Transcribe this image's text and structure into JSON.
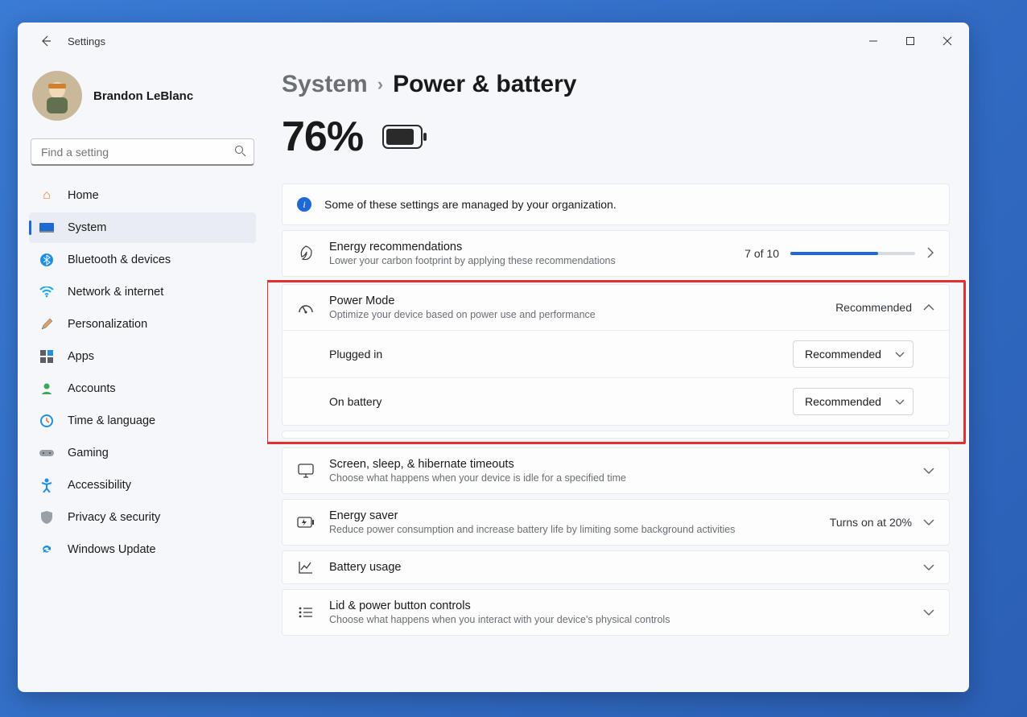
{
  "window": {
    "title": "Settings"
  },
  "user": {
    "name": "Brandon LeBlanc"
  },
  "search": {
    "placeholder": "Find a setting"
  },
  "nav": {
    "items": [
      {
        "label": "Home"
      },
      {
        "label": "System"
      },
      {
        "label": "Bluetooth & devices"
      },
      {
        "label": "Network & internet"
      },
      {
        "label": "Personalization"
      },
      {
        "label": "Apps"
      },
      {
        "label": "Accounts"
      },
      {
        "label": "Time & language"
      },
      {
        "label": "Gaming"
      },
      {
        "label": "Accessibility"
      },
      {
        "label": "Privacy & security"
      },
      {
        "label": "Windows Update"
      }
    ]
  },
  "breadcrumb": {
    "parent": "System",
    "current": "Power & battery"
  },
  "battery": {
    "level": "76%"
  },
  "banner": {
    "text": "Some of these settings are managed by your organization."
  },
  "energy": {
    "title": "Energy recommendations",
    "sub": "Lower your carbon footprint by applying these recommendations",
    "progress_label": "7 of 10",
    "progress_pct": 70
  },
  "power_mode": {
    "title": "Power Mode",
    "sub": "Optimize your device based on power use and performance",
    "summary": "Recommended",
    "plugged_label": "Plugged in",
    "plugged_value": "Recommended",
    "battery_label": "On battery",
    "battery_value": "Recommended"
  },
  "timeouts": {
    "title": "Screen, sleep, & hibernate timeouts",
    "sub": "Choose what happens when your device is idle for a specified time"
  },
  "saver": {
    "title": "Energy saver",
    "sub": "Reduce power consumption and increase battery life by limiting some background activities",
    "summary": "Turns on at 20%"
  },
  "usage": {
    "title": "Battery usage"
  },
  "lid": {
    "title": "Lid & power button controls",
    "sub": "Choose what happens when you interact with your device's physical controls"
  }
}
